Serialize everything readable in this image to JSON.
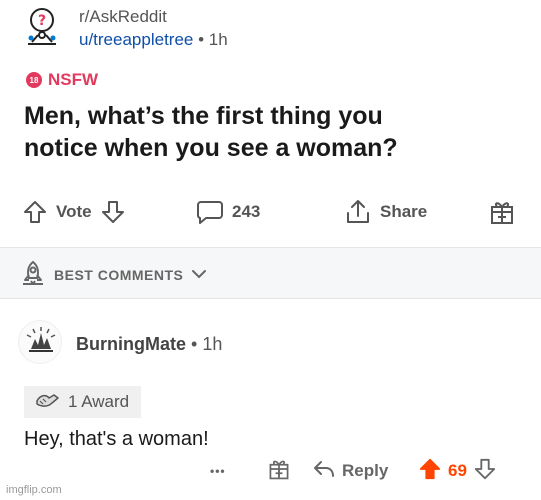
{
  "post": {
    "subreddit": "r/AskReddit",
    "author": "u/treeappletree",
    "separator": "•",
    "age": "1h",
    "nsfw_badge": "18",
    "nsfw_label": "NSFW",
    "title_line1": "Men, what’s the first thing you",
    "title_line2": "notice when you see a woman?",
    "actions": {
      "vote_label": "Vote",
      "comments_count": "243",
      "share_label": "Share"
    }
  },
  "comments_header": {
    "sort_label": "BEST COMMENTS"
  },
  "comment": {
    "author": "BurningMate",
    "separator": "•",
    "age": "1h",
    "award_label": "1 Award",
    "body": "Hey, that's a woman!",
    "more_label": "•••",
    "reply_label": "Reply",
    "score": "69"
  },
  "watermark": "imgflip.com",
  "colors": {
    "nsfw": "#e23a5e",
    "author_link": "#0f4fa8",
    "upvote": "#ff4500"
  },
  "icons": {
    "subreddit": "askreddit-snoo-icon",
    "upvote": "arrow-up-icon",
    "downvote": "arrow-down-icon",
    "comments": "speech-bubble-icon",
    "share": "share-icon",
    "award": "gift-icon",
    "sort": "rocket-icon",
    "chevron": "chevron-down-icon",
    "reply": "reply-arrow-icon"
  }
}
